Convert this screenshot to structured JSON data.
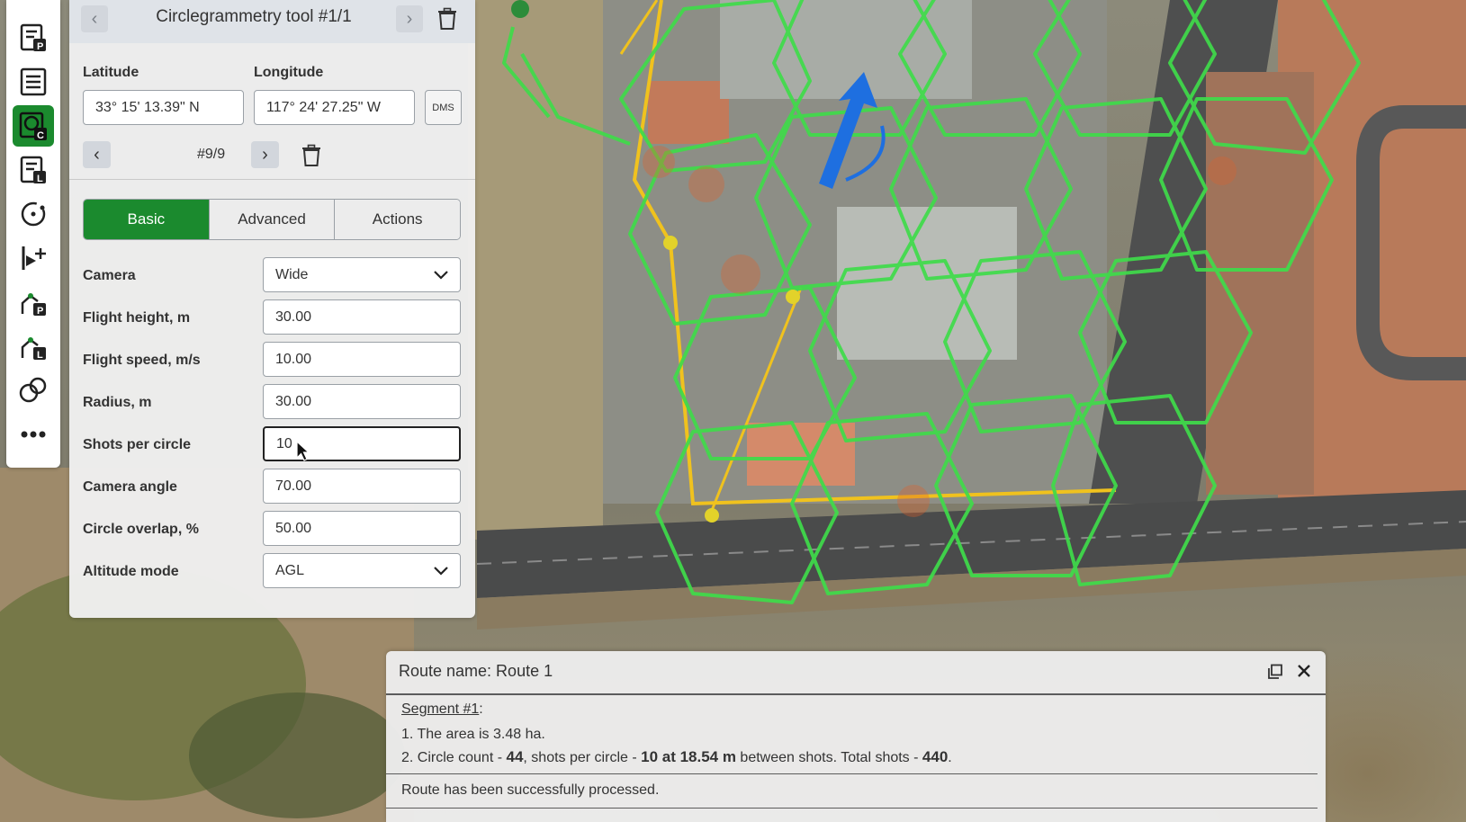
{
  "toolbar": {
    "buttons": [
      {
        "name": "photogrammetry-report-icon"
      },
      {
        "name": "list-icon"
      },
      {
        "name": "circlegrammetry-tool-icon",
        "active": true
      },
      {
        "name": "linear-report-icon"
      },
      {
        "name": "orbit-icon"
      },
      {
        "name": "waypoint-add-icon"
      },
      {
        "name": "polygon-p-icon"
      },
      {
        "name": "polygon-l-icon"
      },
      {
        "name": "shapes-icon"
      },
      {
        "name": "more-icon"
      }
    ]
  },
  "panel": {
    "title": "Circlegrammetry tool #1/1",
    "latitude_label": "Latitude",
    "longitude_label": "Longitude",
    "latitude_value": "33° 15' 13.39\" N",
    "longitude_value": "117° 24' 27.25\" W",
    "format_button": "DMS",
    "segment_index": "#9/9",
    "tabs": [
      {
        "label": "Basic",
        "active": true
      },
      {
        "label": "Advanced",
        "active": false
      },
      {
        "label": "Actions",
        "active": false
      }
    ],
    "fields": {
      "camera": {
        "label": "Camera",
        "value": "Wide"
      },
      "flight_height": {
        "label": "Flight height, m",
        "value": "30.00"
      },
      "flight_speed": {
        "label": "Flight speed, m/s",
        "value": "10.00"
      },
      "radius": {
        "label": "Radius, m",
        "value": "30.00"
      },
      "shots_per_circle": {
        "label": "Shots per circle",
        "value": "10"
      },
      "camera_angle": {
        "label": "Camera angle",
        "value": "70.00"
      },
      "circle_overlap": {
        "label": "Circle overlap, %",
        "value": "50.00"
      },
      "altitude_mode": {
        "label": "Altitude mode",
        "value": "AGL"
      }
    }
  },
  "route": {
    "title": "Route name: Route 1",
    "segment_label": "Segment #1",
    "segment_suffix": ":",
    "area_line": "1. The area is 3.48 ha.",
    "circle_line": {
      "prefix": "2. Circle count - ",
      "circle_count": "44",
      "mid1": ", shots per circle - ",
      "shots_detail": "10 at 18.54 m",
      "mid2": " between shots. Total shots - ",
      "total_shots": "440",
      "suffix": "."
    },
    "status": "Route has been successfully processed."
  },
  "colors": {
    "accent": "#1b8a2e",
    "grid_line": "#3fdc4a",
    "boundary_line": "#f0c21e",
    "direction_arrow": "#1e6fe0"
  }
}
